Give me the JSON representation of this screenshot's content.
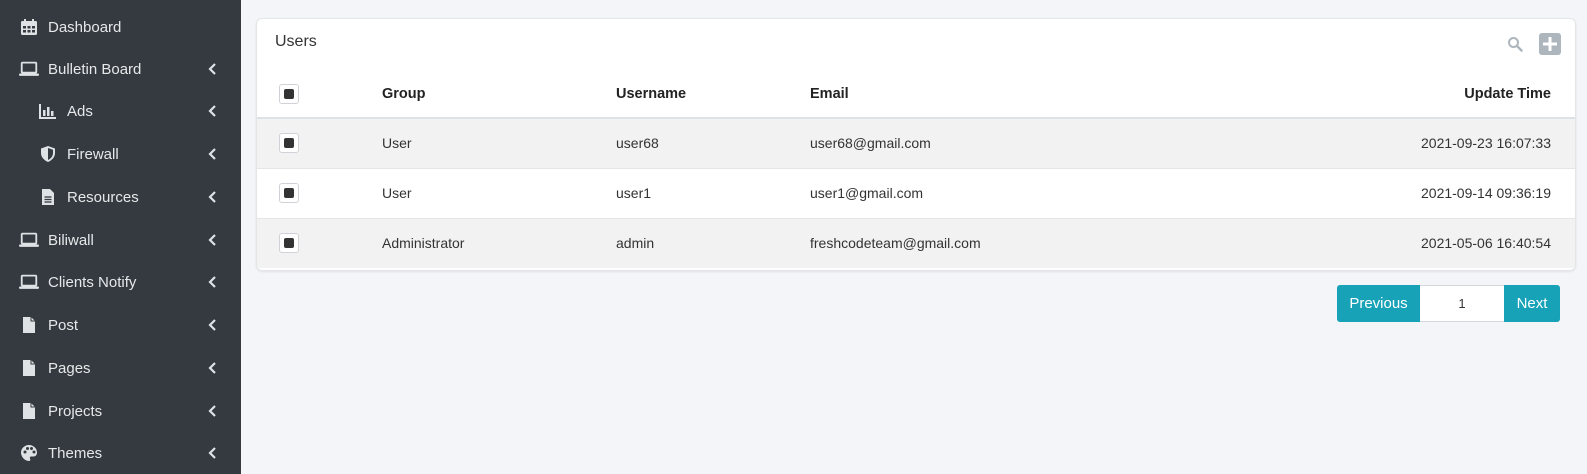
{
  "sidebar": {
    "items": [
      {
        "label": "Dashboard",
        "icon": "calendar-icon"
      },
      {
        "label": "Bulletin Board",
        "icon": "laptop-icon"
      },
      {
        "label": "Ads",
        "icon": "bar-chart-icon"
      },
      {
        "label": "Firewall",
        "icon": "shield-icon"
      },
      {
        "label": "Resources",
        "icon": "file-text-icon"
      },
      {
        "label": "Biliwall",
        "icon": "laptop-icon"
      },
      {
        "label": "Clients Notify",
        "icon": "laptop-icon"
      },
      {
        "label": "Post",
        "icon": "file-icon"
      },
      {
        "label": "Pages",
        "icon": "file-icon"
      },
      {
        "label": "Projects",
        "icon": "file-icon"
      },
      {
        "label": "Themes",
        "icon": "palette-icon"
      }
    ]
  },
  "card": {
    "title": "Users",
    "tools": {
      "search_icon": "search-icon",
      "add_icon": "plus-square-icon"
    }
  },
  "table": {
    "headers": {
      "group": "Group",
      "username": "Username",
      "email": "Email",
      "update_time": "Update Time"
    },
    "rows": [
      {
        "group": "User",
        "username": "user68",
        "email": "user68@gmail.com",
        "update_time": "2021-09-23 16:07:33"
      },
      {
        "group": "User",
        "username": "user1",
        "email": "user1@gmail.com",
        "update_time": "2021-09-14 09:36:19"
      },
      {
        "group": "Administrator",
        "username": "admin",
        "email": "freshcodeteam@gmail.com",
        "update_time": "2021-05-06 16:40:54"
      }
    ]
  },
  "pagination": {
    "previous": "Previous",
    "page": "1",
    "next": "Next"
  },
  "colors": {
    "sidebar_bg": "#343a40",
    "accent": "#17a2b8",
    "page_bg": "#f4f5f8"
  }
}
